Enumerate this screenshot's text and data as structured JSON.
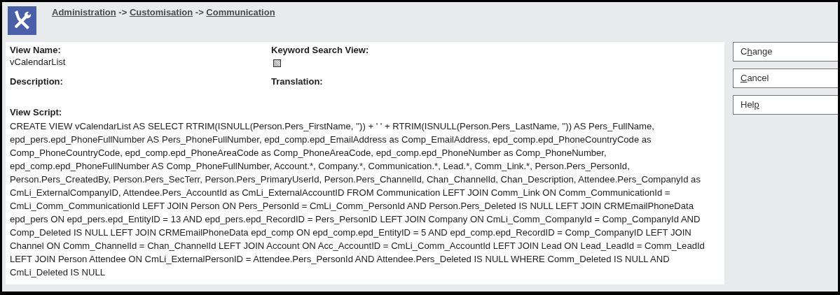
{
  "breadcrumb": [
    {
      "label": "Administration"
    },
    {
      "label": "Customisation"
    },
    {
      "label": "Communication"
    }
  ],
  "breadcrumb_separator": "->",
  "fields": [
    {
      "label": "View Name:",
      "value": "vCalendarList"
    },
    {
      "label": "Keyword Search View:",
      "checkbox": {
        "checked": false,
        "disabled": true
      }
    },
    {
      "label": "Description:"
    },
    {
      "label": "Translation:"
    }
  ],
  "view_script": {
    "label": "View Script:",
    "text": "CREATE VIEW vCalendarList AS SELECT RTRIM(ISNULL(Person.Pers_FirstName, '')) + ' ' + RTRIM(ISNULL(Person.Pers_LastName, '')) AS Pers_FullName, epd_pers.epd_PhoneFullNumber AS Pers_PhoneFullNumber, epd_comp.epd_EmailAddress as Comp_EmailAddress, epd_comp.epd_PhoneCountryCode as Comp_PhoneCountryCode, epd_comp.epd_PhoneAreaCode as Comp_PhoneAreaCode, epd_comp.epd_PhoneNumber as Comp_PhoneNumber, epd_comp.epd_PhoneFullNumber AS Comp_PhoneFullNumber, Account.*, Company.*, Communication.*, Lead.*, Comm_Link.*, Person.Pers_PersonId, Person.Pers_CreatedBy, Person.Pers_SecTerr, Person.Pers_PrimaryUserId, Person.Pers_ChannelId, Chan_ChannelId, Chan_Description, Attendee.Pers_CompanyId as CmLi_ExternalCompanyID, Attendee.Pers_AccountId as CmLi_ExternalAccountID FROM Communication LEFT JOIN Comm_Link ON Comm_CommunicationId = CmLi_Comm_CommunicationId LEFT JOIN Person ON Pers_PersonId = CmLi_Comm_PersonId AND Person.Pers_Deleted IS NULL LEFT JOIN CRMEmailPhoneData epd_pers ON epd_pers.epd_EntityID = 13 AND epd_pers.epd_RecordID = Pers_PersonID LEFT JOIN Company ON CmLi_Comm_CompanyId = Comp_CompanyId AND Comp_Deleted IS NULL LEFT JOIN CRMEmailPhoneData epd_comp ON epd_comp.epd_EntityID = 5 AND epd_comp.epd_RecordID = Comp_CompanyID LEFT JOIN Channel ON Comm_ChannelId = Chan_ChannelId LEFT JOIN Account ON Acc_AccountID = CmLi_Comm_AccountId LEFT JOIN Lead ON Lead_LeadId = Comm_LeadId LEFT JOIN Person Attendee ON CmLi_ExternalPersonID = Attendee.Pers_PersonId AND Attendee.Pers_Deleted IS NULL WHERE Comm_Deleted IS NULL AND CmLi_Deleted IS NULL"
  },
  "buttons": [
    {
      "before": "C",
      "key": "h",
      "after": "ange"
    },
    {
      "key": "C",
      "after": "ancel"
    },
    {
      "before": "Hel",
      "key": "p"
    }
  ]
}
